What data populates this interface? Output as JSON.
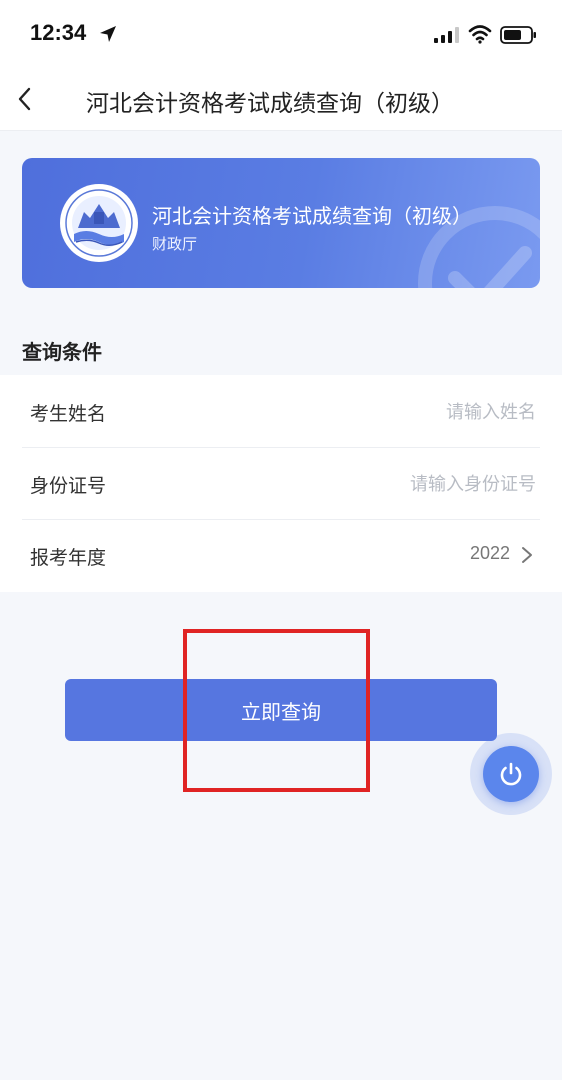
{
  "status_bar": {
    "time": "12:34",
    "icons": [
      "location-arrow-icon",
      "cellular-signal-icon",
      "wifi-icon",
      "battery-icon"
    ]
  },
  "nav": {
    "back_icon": "chevron-left-icon",
    "title": "河北会计资格考试成绩查询（初级）"
  },
  "banner": {
    "logo": "government-seal-logo",
    "title": "河北会计资格考试成绩查询（初级）",
    "subtitle": "财政厅",
    "background_color": "#5676e0"
  },
  "form": {
    "section_title": "查询条件",
    "fields": [
      {
        "label": "考生姓名",
        "placeholder": "请输入姓名",
        "value": ""
      },
      {
        "label": "身份证号",
        "placeholder": "请输入身份证号",
        "value": ""
      },
      {
        "label": "报考年度",
        "value": "2022",
        "icon": "chevron-right-icon"
      }
    ]
  },
  "submit": {
    "label": "立即查询",
    "color": "#5676e0"
  },
  "floating_button": {
    "icon": "power-icon",
    "color": "#5b86ec"
  },
  "annotation": {
    "highlight_color": "#e02424"
  }
}
